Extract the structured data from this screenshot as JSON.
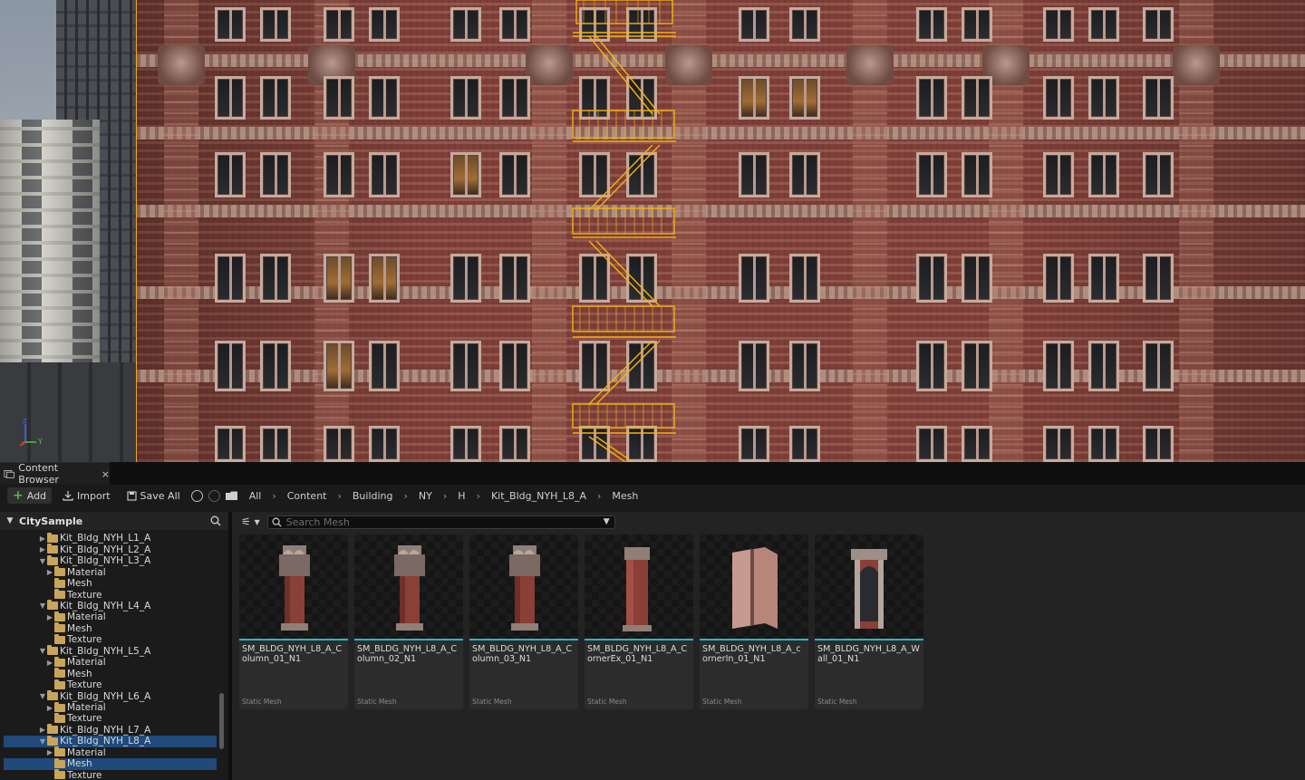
{
  "content_browser": {
    "tab_title": "Content Browser",
    "tab_close": "×",
    "toolbar": {
      "add_label": "Add",
      "import_label": "Import",
      "save_all_label": "Save All"
    },
    "breadcrumbs": [
      "All",
      "Content",
      "Building",
      "NY",
      "H",
      "Kit_Bldg_NYH_L8_A",
      "Mesh"
    ],
    "tree": {
      "root": "CitySample",
      "items": [
        {
          "label": "Kit_Bldg_NYH_L1_A",
          "expanded": false,
          "selected": false,
          "level": 1
        },
        {
          "label": "Kit_Bldg_NYH_L2_A",
          "expanded": false,
          "selected": false,
          "level": 1
        },
        {
          "label": "Kit_Bldg_NYH_L3_A",
          "expanded": true,
          "selected": false,
          "level": 1
        },
        {
          "label": "Material",
          "expanded": false,
          "selected": false,
          "level": 2
        },
        {
          "label": "Mesh",
          "expanded": null,
          "selected": false,
          "level": 2
        },
        {
          "label": "Texture",
          "expanded": null,
          "selected": false,
          "level": 2
        },
        {
          "label": "Kit_Bldg_NYH_L4_A",
          "expanded": true,
          "selected": false,
          "level": 1
        },
        {
          "label": "Material",
          "expanded": false,
          "selected": false,
          "level": 2
        },
        {
          "label": "Mesh",
          "expanded": null,
          "selected": false,
          "level": 2
        },
        {
          "label": "Texture",
          "expanded": null,
          "selected": false,
          "level": 2
        },
        {
          "label": "Kit_Bldg_NYH_L5_A",
          "expanded": true,
          "selected": false,
          "level": 1
        },
        {
          "label": "Material",
          "expanded": false,
          "selected": false,
          "level": 2
        },
        {
          "label": "Mesh",
          "expanded": null,
          "selected": false,
          "level": 2
        },
        {
          "label": "Texture",
          "expanded": null,
          "selected": false,
          "level": 2
        },
        {
          "label": "Kit_Bldg_NYH_L6_A",
          "expanded": true,
          "selected": false,
          "level": 1
        },
        {
          "label": "Material",
          "expanded": false,
          "selected": false,
          "level": 2
        },
        {
          "label": "Texture",
          "expanded": null,
          "selected": false,
          "level": 2
        },
        {
          "label": "Kit_Bldg_NYH_L7_A",
          "expanded": false,
          "selected": false,
          "level": 1
        },
        {
          "label": "Kit_Bldg_NYH_L8_A",
          "expanded": true,
          "selected": true,
          "level": 1
        },
        {
          "label": "Material",
          "expanded": false,
          "selected": false,
          "level": 2
        },
        {
          "label": "Mesh",
          "expanded": null,
          "selected": true,
          "level": 2
        },
        {
          "label": "Texture",
          "expanded": null,
          "selected": false,
          "level": 2
        }
      ]
    },
    "search": {
      "placeholder": "Search Mesh"
    },
    "assets": [
      {
        "name": "SM_BLDG_NYH_L8_A_Column_01_N1",
        "type": "Static Mesh",
        "shape": "column"
      },
      {
        "name": "SM_BLDG_NYH_L8_A_Column_02_N1",
        "type": "Static Mesh",
        "shape": "column"
      },
      {
        "name": "SM_BLDG_NYH_L8_A_Column_03_N1",
        "type": "Static Mesh",
        "shape": "column"
      },
      {
        "name": "SM_BLDG_NYH_L8_A_CornerEx_01_N1",
        "type": "Static Mesh",
        "shape": "corner"
      },
      {
        "name": "SM_BLDG_NYH_L8_A_cornerIn_01_N1",
        "type": "Static Mesh",
        "shape": "cornerin"
      },
      {
        "name": "SM_BLDG_NYH_L8_A_Wall_01_N1",
        "type": "Static Mesh",
        "shape": "wall"
      }
    ]
  },
  "viewport": {
    "axis_labels": {
      "x": "x",
      "y": "Y",
      "z": "Z"
    },
    "selection_color": "#f5b20f"
  },
  "colors": {
    "accent_cyan": "#27b8c7",
    "selection_blue": "#1f4a7a",
    "folder": "#c9a45a",
    "add_green": "#5db14e"
  }
}
